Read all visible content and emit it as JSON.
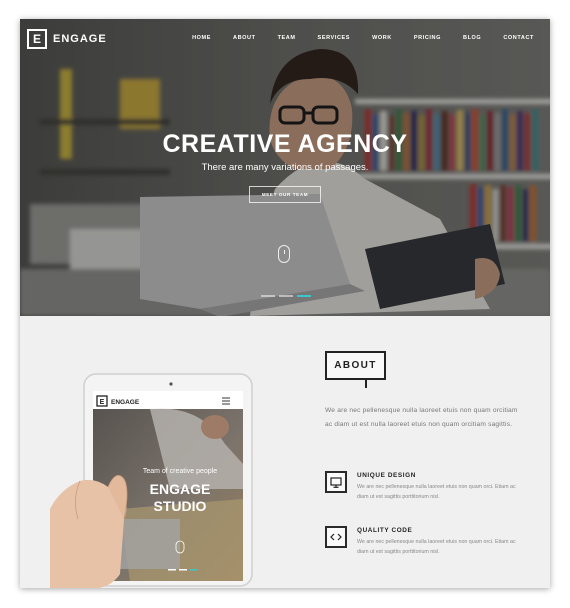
{
  "brand": {
    "logo_letter": "E",
    "name": "ENGAGE"
  },
  "nav": {
    "items": [
      "HOME",
      "ABOUT",
      "TEAM",
      "SERVICES",
      "WORK",
      "PRICING",
      "BLOG",
      "CONTACT"
    ]
  },
  "hero": {
    "title": "CREATIVE AGENCY",
    "subtitle": "There are many variations of passages.",
    "button": "MEET OUR TEAM",
    "active_slide": 3,
    "slide_count": 3
  },
  "about": {
    "heading": "ABOUT",
    "paragraph": "We are nec pellenesque nulla laoreet etuis non quam orcitiam ac diam ut est nulla laoreet etuis non quam orcitiam sagittis."
  },
  "features": [
    {
      "icon": "monitor-icon",
      "title": "UNIQUE DESIGN",
      "description": "We are nec pellenesque nulla laoreet etuis non quam orci. Etiam ac diam ut est sagittis porttitorium nisl."
    },
    {
      "icon": "code-icon",
      "title": "QUALITY CODE",
      "description": "We are nec pellenesque nulla laoreet etuis non quam orci. Etiam ac diam ut est sagittis porttitorium nisl."
    }
  ],
  "tablet": {
    "brand": "ENGAGE",
    "tagline": "Team of creative people",
    "title_line1": "ENGAGE",
    "title_line2": "STUDIO"
  },
  "colors": {
    "accent": "#3cc6c8",
    "dark": "#222222",
    "section_bg": "#f0f0f0"
  }
}
